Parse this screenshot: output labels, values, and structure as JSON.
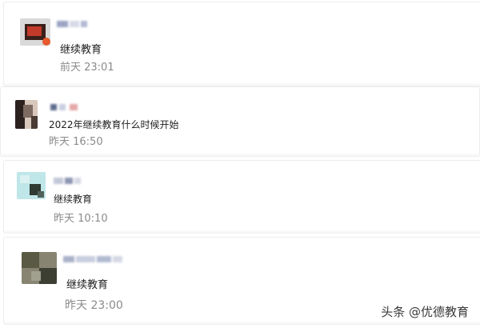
{
  "comments": [
    {
      "avatar_icon": "user-avatar-icon",
      "avatar_colors": [
        "#c23a2a",
        "#3a1f1a",
        "#b8b8b8",
        "#e65a2e"
      ],
      "message": "继续教育",
      "time": "前天 23:01"
    },
    {
      "avatar_icon": "user-avatar-icon",
      "avatar_colors": [
        "#2b2220",
        "#7d6a60",
        "#d8c7bb",
        "#4a3b33"
      ],
      "message": "2022年继续教育什么时候开始",
      "time": "昨天 16:50"
    },
    {
      "avatar_icon": "user-avatar-icon",
      "avatar_colors": [
        "#bfe6e8",
        "#2f3a33",
        "#dbf1f2",
        "#52605a"
      ],
      "message": "继续教育",
      "time": "昨天 10:10"
    },
    {
      "avatar_icon": "user-avatar-icon",
      "avatar_colors": [
        "#5a5a44",
        "#878472",
        "#3e3f33",
        "#a19f8d"
      ],
      "message": "继续教育",
      "time": "昨天 23:00"
    }
  ],
  "watermark": "头条 @优德教育"
}
